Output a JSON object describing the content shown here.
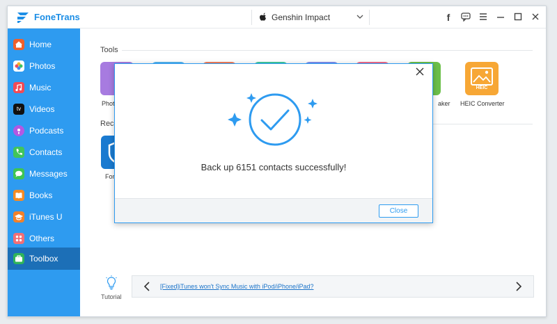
{
  "app": {
    "name": "FoneTrans"
  },
  "device": {
    "name": "Genshin Impact"
  },
  "titlebar": {
    "icons": [
      "facebook-icon",
      "chat-icon",
      "menu-icon",
      "minimize-icon",
      "maximize-icon",
      "close-icon"
    ]
  },
  "sidebar": {
    "items": [
      {
        "label": "Home",
        "icon": "home-icon",
        "color": "#f0602b"
      },
      {
        "label": "Photos",
        "icon": "photos-icon",
        "color": "#ffffff"
      },
      {
        "label": "Music",
        "icon": "music-icon",
        "color": "#f24a55"
      },
      {
        "label": "Videos",
        "icon": "tv-icon",
        "color": "#111111"
      },
      {
        "label": "Podcasts",
        "icon": "podcasts-icon",
        "color": "#b258e3"
      },
      {
        "label": "Contacts",
        "icon": "contacts-icon",
        "color": "#41c55a"
      },
      {
        "label": "Messages",
        "icon": "messages-icon",
        "color": "#3ec553"
      },
      {
        "label": "Books",
        "icon": "books-icon",
        "color": "#f58b24"
      },
      {
        "label": "iTunes U",
        "icon": "itunes-u-icon",
        "color": "#f2812a"
      },
      {
        "label": "Others",
        "icon": "others-icon",
        "color": "#f26f76"
      },
      {
        "label": "Toolbox",
        "icon": "toolbox-icon",
        "color": "#2fb45a",
        "active": true
      }
    ]
  },
  "main": {
    "tools_title": "Tools",
    "recommended_title": "Reco",
    "tools": [
      {
        "label": "Photo",
        "color": "#a77be0"
      },
      {
        "label": "",
        "color": "#4fb3f0"
      },
      {
        "label": "",
        "color": "#f07d5a"
      },
      {
        "label": "",
        "color": "#3dc9a1"
      },
      {
        "label": "",
        "color": "#7b8ef0"
      },
      {
        "label": "",
        "color": "#f0698a"
      },
      {
        "label": "aker",
        "color": "#6cc04a"
      }
    ],
    "heic": {
      "label": "HEIC Converter",
      "badge": "HEIC",
      "color": "#f7a735"
    },
    "recommended": [
      {
        "label": "Fon",
        "color": "#1a7ad0"
      }
    ]
  },
  "tutorial": {
    "label": "Tutorial",
    "tip_link": "[Fixed]iTunes won't Sync Music with iPod/iPhone/iPad?"
  },
  "modal": {
    "message": "Back up 6151 contacts successfully!",
    "close_label": "Close",
    "accent": "#2e9bf0"
  }
}
